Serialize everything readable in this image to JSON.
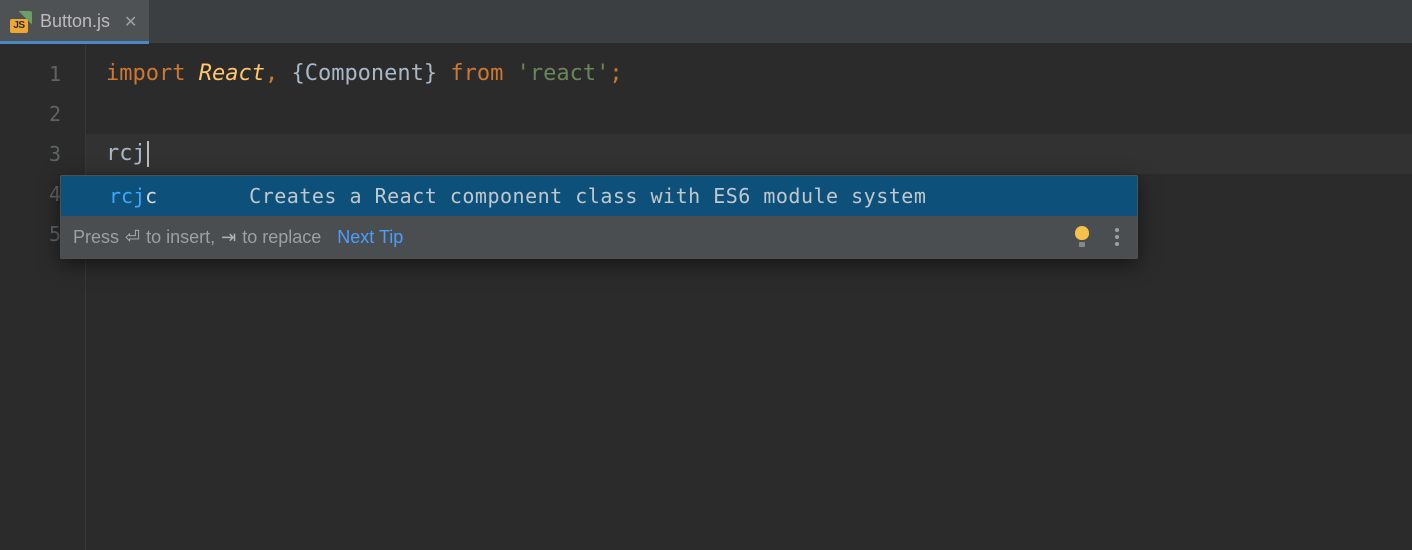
{
  "tab": {
    "filename": "Button.js",
    "icon_label": "JS"
  },
  "gutter": {
    "lines": [
      "1",
      "2",
      "3",
      "4",
      "5"
    ]
  },
  "code": {
    "line1": {
      "kw_import": "import ",
      "react": "React",
      "comma": ", ",
      "lbrace": "{",
      "component": "Component",
      "rbrace": "}",
      "kw_from": " from ",
      "q1": "'",
      "mod": "react",
      "q2": "'",
      "semi": ";"
    },
    "line3": {
      "text": "rcj"
    }
  },
  "autocomplete": {
    "item": {
      "match": "rcj",
      "rest": "c",
      "description": "Creates a React component class with ES6 module system"
    },
    "hint": {
      "press": "Press ",
      "enter_glyph": "⏎",
      "to_insert": " to insert, ",
      "tab_glyph": "⇥",
      "to_replace": " to replace",
      "next_tip": "Next Tip"
    }
  }
}
